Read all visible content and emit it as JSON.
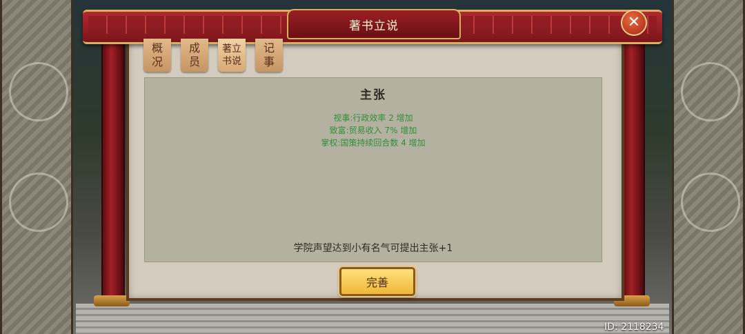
{
  "window": {
    "title": "著书立说"
  },
  "tabs": [
    {
      "line1": "概",
      "line2": "况"
    },
    {
      "line1": "成",
      "line2": "员"
    },
    {
      "line1": "著立",
      "line2": "书说"
    },
    {
      "line1": "记",
      "line2": "事"
    }
  ],
  "content": {
    "heading": "主张",
    "effects": [
      "视事:行政效率 2 增加",
      "致富:贸易收入 7% 增加",
      "掌权:国策持续回合数 4 增加"
    ],
    "note": "学院声望达到小有名气可提出主张+1"
  },
  "buttons": {
    "improve_label": "完善",
    "close_glyph": "✕"
  },
  "footer": {
    "id_text": "ID: 2118234"
  },
  "icons": {
    "close": "close-icon"
  },
  "colors": {
    "effect_text": "#2f8f3a",
    "frame_red": "#a32027",
    "gold": "#d8b15a"
  }
}
